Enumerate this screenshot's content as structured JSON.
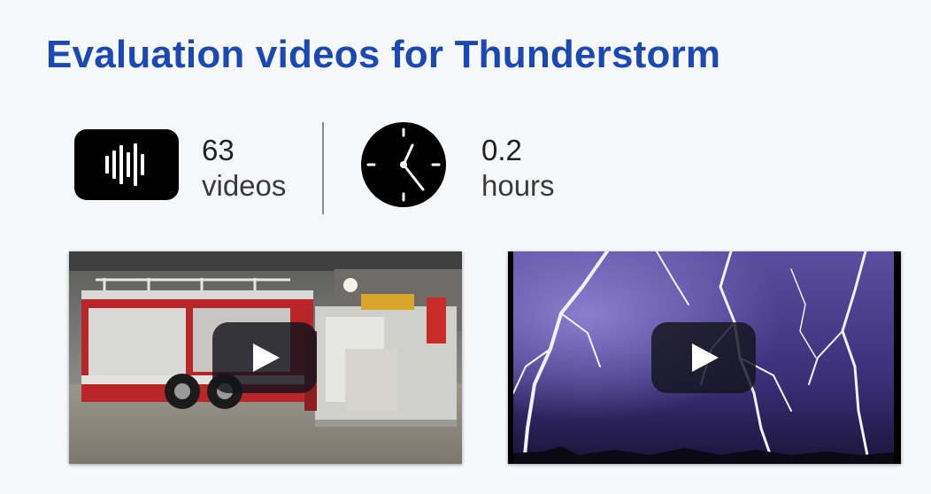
{
  "page": {
    "title": "Evaluation videos for Thunderstorm"
  },
  "stats": {
    "videos": {
      "count": "63",
      "label": "videos",
      "icon": "video-waveform-icon"
    },
    "hours": {
      "count": "0.2",
      "label": "hours",
      "icon": "clock-icon"
    }
  },
  "thumbnails": [
    {
      "subject": "fire trucks in garage",
      "icon": "play-icon"
    },
    {
      "subject": "lightning storm",
      "icon": "play-icon"
    }
  ],
  "colors": {
    "title": "#1a49b5",
    "background": "#f7f8fa",
    "icon": "#000000",
    "divider": "#8c8c8c"
  }
}
